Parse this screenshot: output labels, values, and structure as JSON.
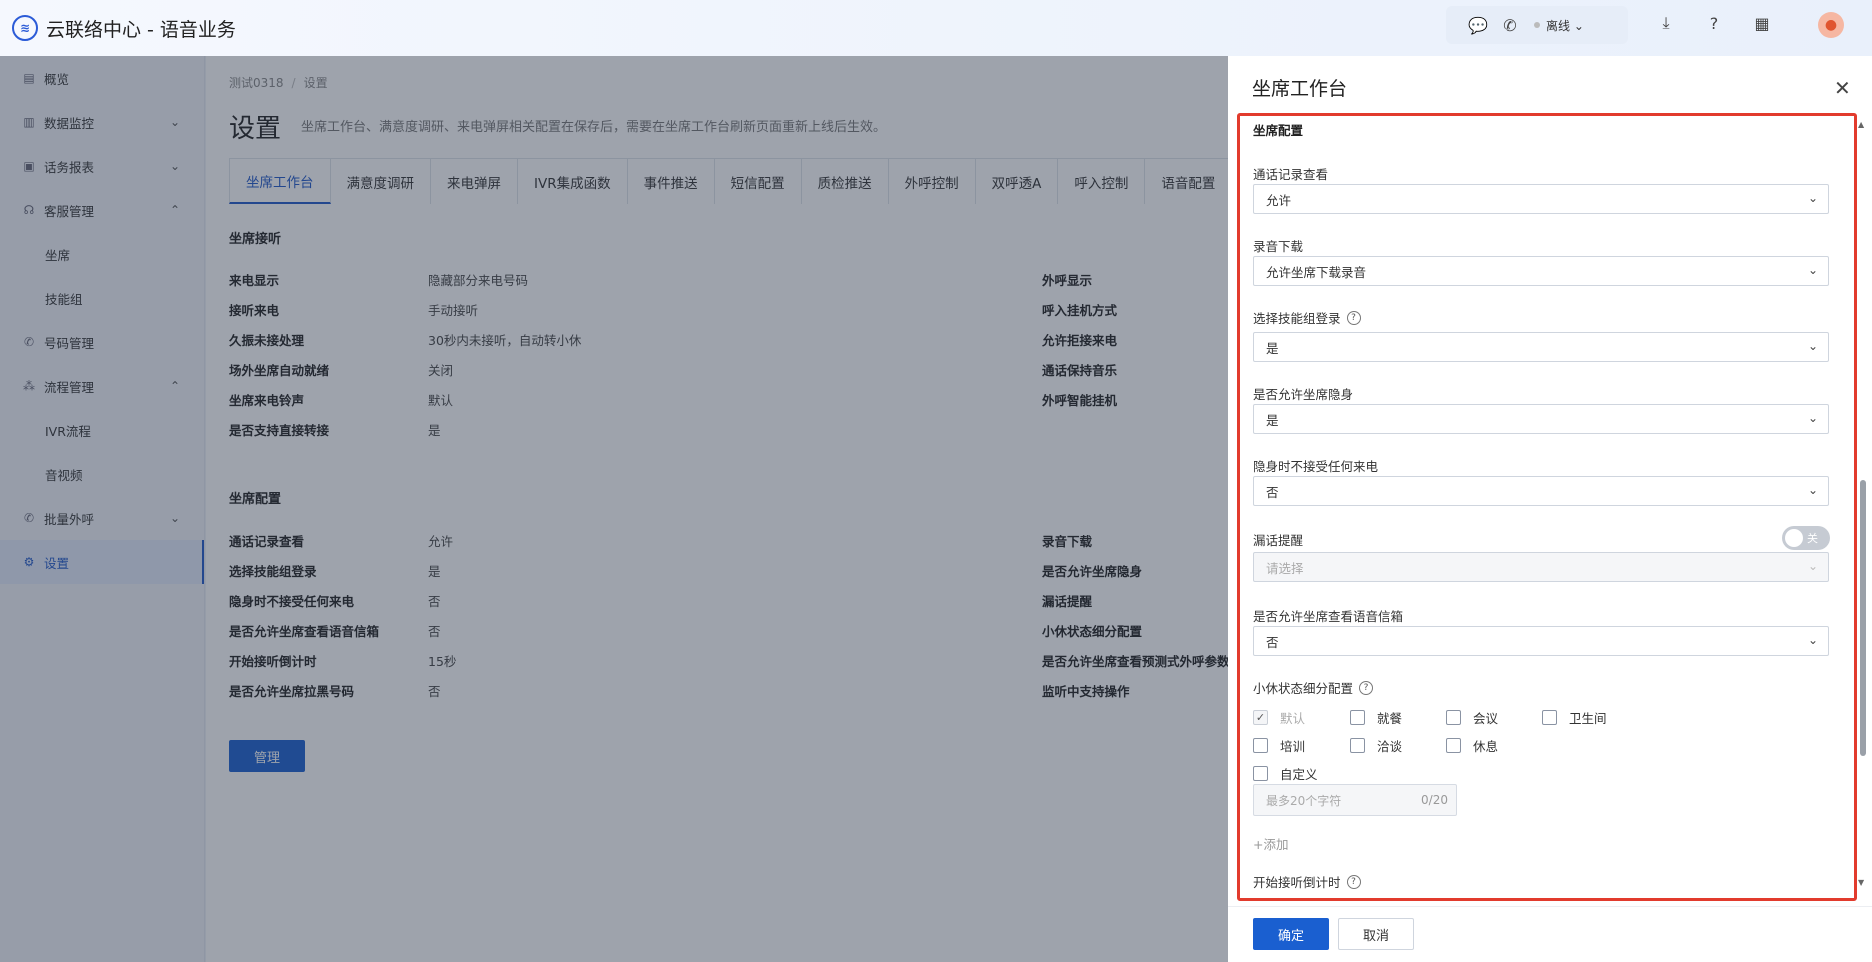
{
  "app": {
    "title": "云联络中心 - 语音业务"
  },
  "topbar": {
    "status_label": "离线",
    "icons": [
      "chat-icon",
      "phone-icon",
      "download-icon",
      "help-icon",
      "apps-icon"
    ]
  },
  "sidebar": {
    "items": [
      {
        "label": "概览",
        "icon": "overview-icon"
      },
      {
        "label": "数据监控",
        "icon": "monitor-icon"
      },
      {
        "label": "话务报表",
        "icon": "report-icon"
      },
      {
        "label": "客服管理",
        "icon": "headset-icon"
      },
      {
        "label": "坐席"
      },
      {
        "label": "技能组"
      },
      {
        "label": "号码管理",
        "icon": "phone-icon"
      },
      {
        "label": "流程管理",
        "icon": "flow-icon"
      },
      {
        "label": "IVR流程"
      },
      {
        "label": "音视频"
      },
      {
        "label": "批量外呼",
        "icon": "phone-icon"
      },
      {
        "label": "设置",
        "icon": "gear-icon"
      }
    ]
  },
  "main": {
    "breadcrumb": [
      "测试0318",
      "设置"
    ],
    "title": "设置",
    "description": "坐席工作台、满意度调研、来电弹屏相关配置在保存后，需要在坐席工作台刷新页面重新上线后生效。",
    "tabs": [
      "坐席工作台",
      "满意度调研",
      "来电弹屏",
      "IVR集成函数",
      "事件推送",
      "短信配置",
      "质检推送",
      "外呼控制",
      "双呼透A",
      "呼入控制",
      "语音配置"
    ],
    "section_answer": {
      "title": "坐席接听",
      "left": [
        {
          "k": "来电显示",
          "v": "隐藏部分来电号码"
        },
        {
          "k": "接听来电",
          "v": "手动接听"
        },
        {
          "k": "久振未接处理",
          "v": "30秒内未接听，自动转小休"
        },
        {
          "k": "场外坐席自动就绪",
          "v": "关闭"
        },
        {
          "k": "坐席来电铃声",
          "v": "默认"
        },
        {
          "k": "是否支持直接转接",
          "v": "是"
        }
      ],
      "right": [
        "外呼显示",
        "呼入挂机方式",
        "允许拒接来电",
        "通话保持音乐",
        "外呼智能挂机"
      ]
    },
    "section_config": {
      "title": "坐席配置",
      "left": [
        {
          "k": "通话记录查看",
          "v": "允许"
        },
        {
          "k": "选择技能组登录",
          "v": "是"
        },
        {
          "k": "隐身时不接受任何来电",
          "v": "否"
        },
        {
          "k": "是否允许坐席查看语音信箱",
          "v": "否"
        },
        {
          "k": "开始接听倒计时",
          "v": "15秒"
        },
        {
          "k": "是否允许坐席拉黑号码",
          "v": "否"
        }
      ],
      "right": [
        "录音下载",
        "是否允许坐席隐身",
        "漏话提醒",
        "小休状态细分配置",
        "是否允许坐席查看预测式外呼参数",
        "监听中支持操作"
      ]
    },
    "manage_label": "管理"
  },
  "drawer": {
    "title": "坐席工作台",
    "section_title": "坐席配置",
    "fields": [
      {
        "label": "通话记录查看",
        "value": "允许"
      },
      {
        "label": "录音下载",
        "value": "允许坐席下载录音"
      },
      {
        "label": "选择技能组登录",
        "value": "是",
        "help": true
      },
      {
        "label": "是否允许坐席隐身",
        "value": "是"
      },
      {
        "label": "隐身时不接受任何来电",
        "value": "否"
      }
    ],
    "missed_call": {
      "label": "漏话提醒",
      "toggle": "关",
      "placeholder": "请选择"
    },
    "voicemail": {
      "label": "是否允许坐席查看语音信箱",
      "value": "否"
    },
    "break_config": {
      "label": "小休状态细分配置",
      "options": [
        {
          "label": "默认",
          "checked": true,
          "disabled": true
        },
        {
          "label": "就餐",
          "checked": false
        },
        {
          "label": "会议",
          "checked": false
        },
        {
          "label": "卫生间",
          "checked": false
        },
        {
          "label": "培训",
          "checked": false
        },
        {
          "label": "洽谈",
          "checked": false
        },
        {
          "label": "休息",
          "checked": false
        },
        {
          "label": "自定义",
          "checked": false
        }
      ],
      "custom_placeholder": "最多20个字符",
      "custom_count": "0/20",
      "add_label": "+添加"
    },
    "countdown_label": "开始接听倒计时",
    "ok_label": "确定",
    "cancel_label": "取消"
  },
  "colors": {
    "primary": "#1a5fd0",
    "highlight": "#e23b2d"
  }
}
